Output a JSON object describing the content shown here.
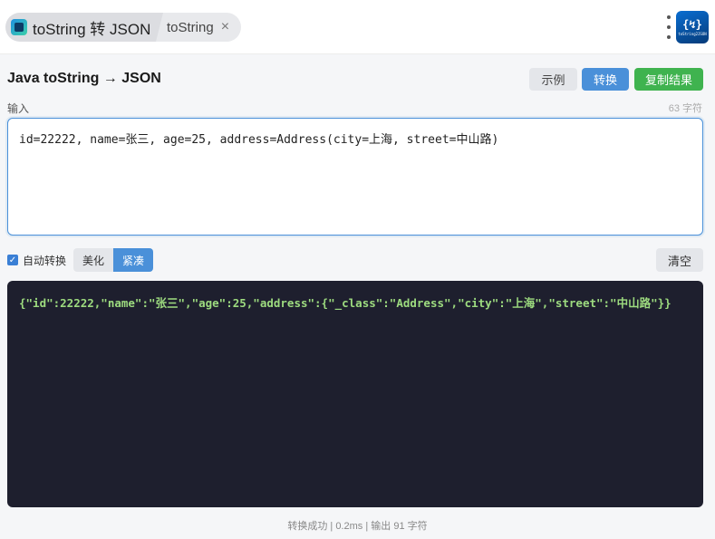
{
  "tabs": {
    "active_title": "toString 转 JSON",
    "inactive_title": "toString",
    "close_glyph": "×"
  },
  "logo": {
    "braces": "{↯}",
    "text": "toString2JSON"
  },
  "page": {
    "title": "Java toString → JSON"
  },
  "toolbar": {
    "example_label": "示例",
    "convert_label": "转换",
    "copy_label": "复制结果"
  },
  "input": {
    "label": "输入",
    "char_count": "63 字符",
    "value": "id=22222, name=张三, age=25, address=Address(city=上海, street=中山路)"
  },
  "options": {
    "auto_convert_label": "自动转换",
    "auto_convert_checked": true,
    "pretty_label": "美化",
    "compact_label": "紧凑",
    "selected_mode": "紧凑",
    "clear_label": "清空"
  },
  "output": {
    "value": "{\"id\":22222,\"name\":\"张三\",\"age\":25,\"address\":{\"_class\":\"Address\",\"city\":\"上海\",\"street\":\"中山路\"}}"
  },
  "status": {
    "text": "转换成功 | 0.2ms | 输出 91 字符"
  },
  "colors": {
    "accent": "#4a90d9",
    "success": "#3fb34f",
    "output_bg": "#1e1f2e",
    "output_text": "#9ddb7f"
  }
}
